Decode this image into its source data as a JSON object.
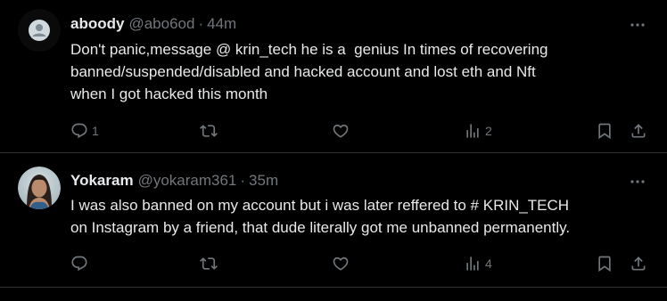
{
  "tweets": [
    {
      "display_name": "aboody",
      "handle": "@abo6od",
      "separator": "·",
      "time": "44m",
      "text": "Don't panic,message @ krin_tech he is a  genius In times of recovering\nbanned/suspended/disabled and hacked account and lost eth and Nft\nwhen I got hacked this month",
      "replies": "1",
      "reposts": "",
      "likes": "",
      "views": "2",
      "avatar_icon": "default-avatar-icon"
    },
    {
      "display_name": "Yokaram",
      "handle": "@yokaram361",
      "separator": "·",
      "time": "35m",
      "text": "I was also banned on my account but i was later reffered to # KRIN_TECH\non Instagram by a friend, that dude literally got me unbanned permanently.",
      "replies": "",
      "reposts": "",
      "likes": "",
      "views": "4",
      "avatar_icon": "profile-photo"
    }
  ],
  "icons": {
    "reply": "reply-icon",
    "repost": "repost-icon",
    "like": "like-icon",
    "views": "views-icon",
    "bookmark": "bookmark-icon",
    "share": "share-icon",
    "more": "more-icon"
  },
  "colors": {
    "background": "#000000",
    "text": "#e7e9ea",
    "muted": "#71767b",
    "divider": "#2f3336"
  }
}
